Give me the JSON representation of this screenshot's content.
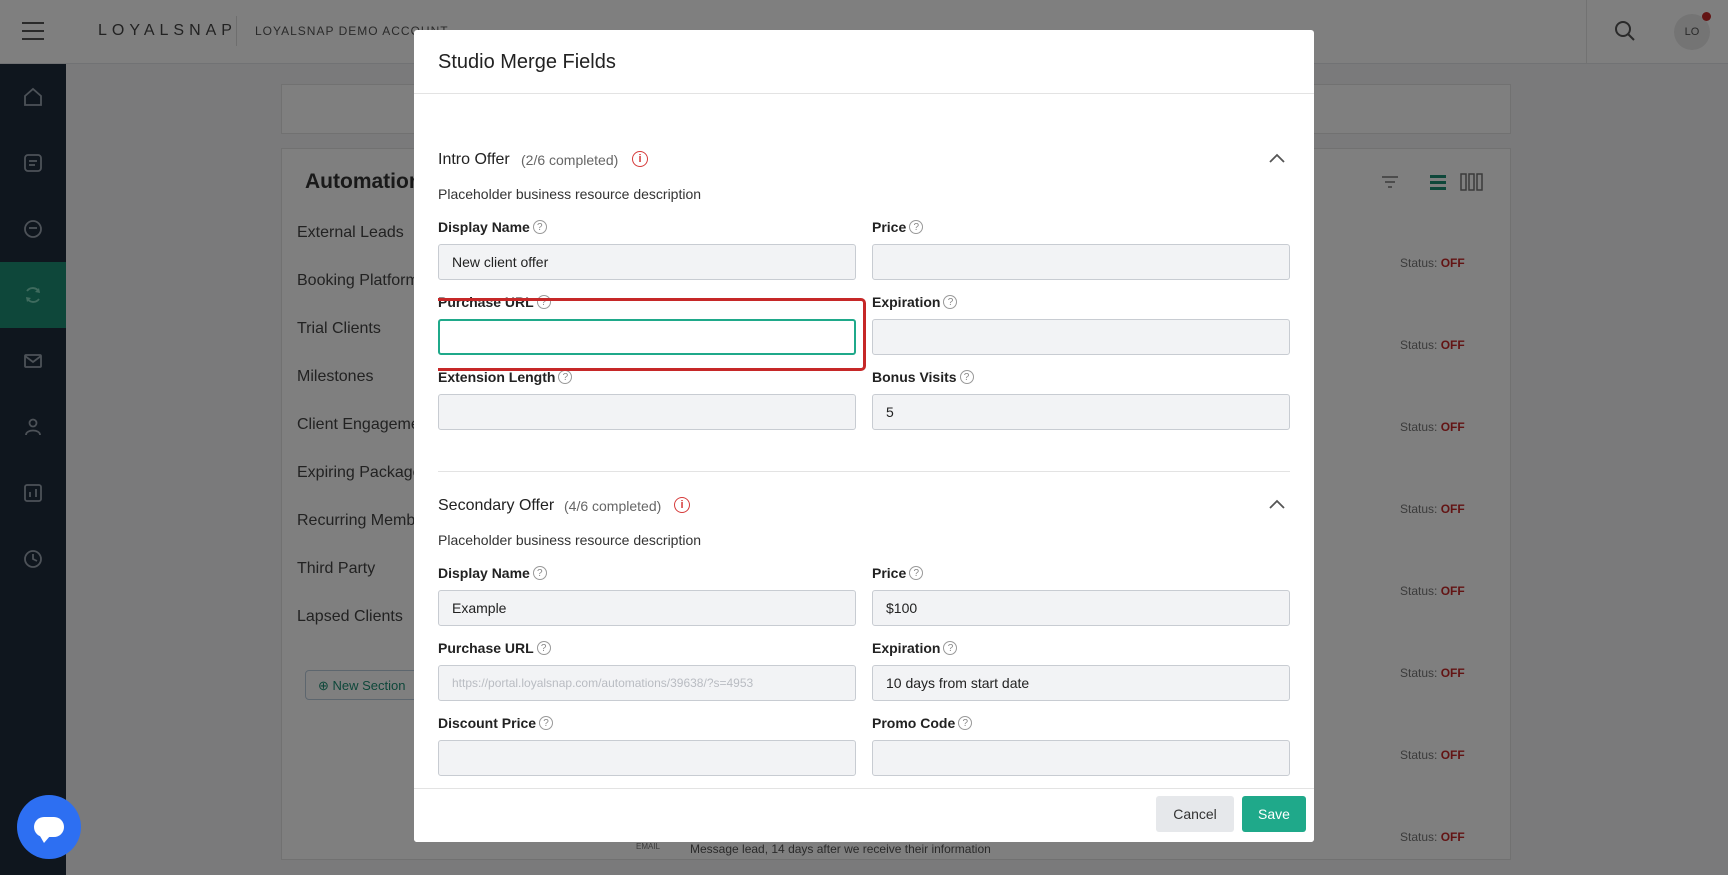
{
  "topbar": {
    "brand": "LOYALSNAP",
    "account": "LOYALSNAP DEMO ACCOUNT",
    "avatar_initials": "LO"
  },
  "sidenav": {
    "items": [
      "home-icon",
      "tasks-icon",
      "chat-icon",
      "automations-icon",
      "mail-icon",
      "people-icon",
      "reports-icon",
      "history-icon"
    ],
    "active_index": 3
  },
  "background": {
    "title": "Automations",
    "sections": [
      "External Leads",
      "Booking Platforms",
      "Trial Clients",
      "Milestones",
      "Client Engagement",
      "Expiring Packages",
      "Recurring Memberships",
      "Third Party",
      "Lapsed Clients"
    ],
    "new_section_label": "New Section",
    "status_label": "Status:",
    "status_value": "OFF",
    "bottom_email_tag": "EMAIL",
    "bottom_text": "Message lead, 14 days after we receive their information"
  },
  "modal": {
    "title": "Studio Merge Fields",
    "sections": [
      {
        "title": "Intro Offer",
        "count": "(2/6 completed)",
        "description": "Placeholder business resource description",
        "fields": [
          {
            "label": "Display Name",
            "value": ""
          },
          {
            "label": "Price",
            "value": ""
          },
          {
            "label": "Purchase URL",
            "value": ""
          },
          {
            "label": "Expiration",
            "value": ""
          },
          {
            "label": "Extension Length",
            "value": ""
          },
          {
            "label": "Bonus Visits",
            "value": "5"
          }
        ],
        "display_name_value": "New client offer"
      },
      {
        "title": "Secondary Offer",
        "count": "(4/6 completed)",
        "description": "Placeholder business resource description",
        "fields": [
          {
            "label": "Display Name",
            "value": "Example"
          },
          {
            "label": "Price",
            "value": "$100"
          },
          {
            "label": "Purchase URL",
            "value": "https://portal.loyalsnap.com/automations/39638/?s=4953"
          },
          {
            "label": "Expiration",
            "value": "10 days from start date"
          },
          {
            "label": "Discount Price",
            "value": ""
          },
          {
            "label": "Promo Code",
            "value": ""
          }
        ]
      }
    ],
    "cancel_label": "Cancel",
    "save_label": "Save"
  },
  "colors": {
    "accent": "#1fa98a",
    "nav_bg": "#1f2d3d",
    "alert": "#c62828",
    "chat": "#2d6ff2"
  }
}
